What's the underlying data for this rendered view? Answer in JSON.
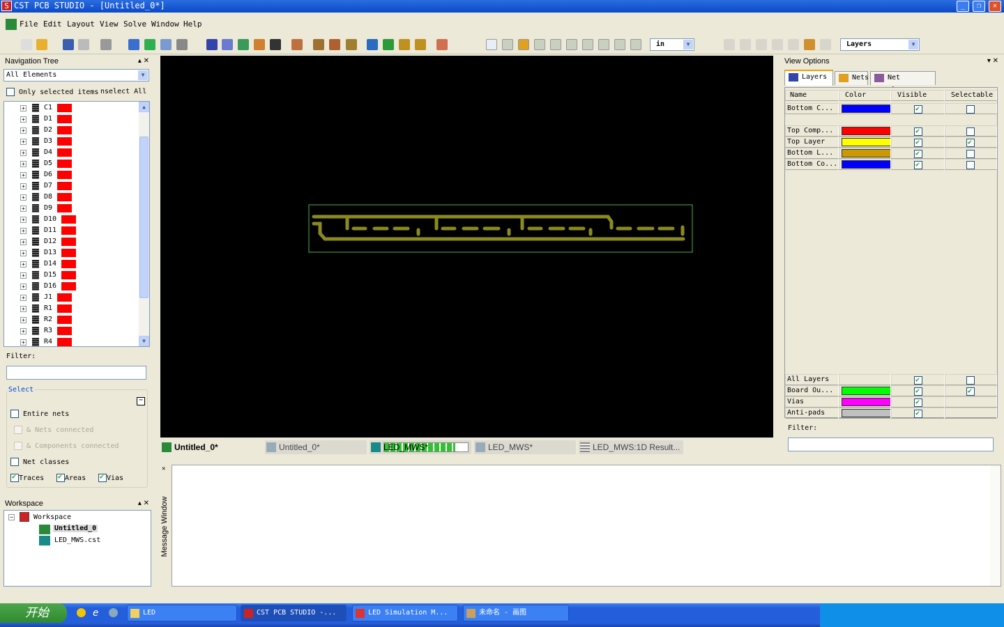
{
  "window": {
    "title": "CST PCB STUDIO - [Untitled_0*]",
    "logo": "S"
  },
  "menu": [
    "File",
    "Edit",
    "Layout",
    "View",
    "Solve",
    "Window",
    "Help"
  ],
  "toolbar": {
    "icons": [
      "new-file-icon",
      "open-folder-icon",
      "save-icon",
      "copy-icon",
      "print-icon",
      "import-icon",
      "circle-icon",
      "add-component-icon",
      "netlist-icon",
      "layers-icon",
      "calculator-icon",
      "check-icon",
      "net-icon",
      "chip-icon",
      "verify-icon",
      "trace-icon",
      "nets-icon",
      "component-icon",
      "ir-solver-icon",
      "pi-solver-icon",
      "fd-solver-icon",
      "td-solver-icon",
      "export-icon"
    ],
    "view_icons": [
      "select-arrow-icon",
      "zoom-icon",
      "pan-icon",
      "zoom-fit-icon",
      "zoom-window-icon",
      "grid1-icon",
      "grid2-icon",
      "grid3-icon",
      "grid4-icon",
      "grid5-icon"
    ],
    "unit_select": "in",
    "layers_select": "Layers",
    "right_icons": [
      "select-rect-icon",
      "probe-icon",
      "text-icon",
      "pin-icon",
      "grid-icon",
      "magnet-icon",
      "frame-icon"
    ]
  },
  "nav": {
    "title": "Navigation Tree",
    "filter_select": "All Elements",
    "only_selected": "Only selected items",
    "unselect_all": "nselect All",
    "items": [
      "C1",
      "D1",
      "D2",
      "D3",
      "D4",
      "D5",
      "D6",
      "D7",
      "D8",
      "D9",
      "D10",
      "D11",
      "D12",
      "D13",
      "D14",
      "D15",
      "D16",
      "J1",
      "R1",
      "R2",
      "R3",
      "R4"
    ],
    "swatch_color": "#ff0000",
    "filter_label": "Filter:",
    "filter_value": "",
    "select_group": "Select",
    "entire_nets": "Entire nets",
    "nets_connected": "& Nets connected",
    "components_connected": "& Components connected",
    "net_classes": "Net classes",
    "traces": "Traces",
    "areas": "Areas",
    "vias": "Vias"
  },
  "workspace": {
    "title": "Workspace",
    "root": "Workspace",
    "items": [
      "Untitled_0",
      "LED_MWS.cst"
    ]
  },
  "doc_tabs": [
    "Untitled_0*",
    "Untitled_0*",
    "LED_MWS*",
    "LED_MWS*",
    "LED_MWS:1D Result..."
  ],
  "progress": 0.85,
  "message_window": {
    "label": "Message Window"
  },
  "view_options": {
    "title": "View Options",
    "tabs": [
      "Layers",
      "Nets",
      "Net Classes"
    ],
    "columns": [
      "Name",
      "Color",
      "Visible",
      "Selectable"
    ],
    "rows": [
      {
        "name": "Bottom C...",
        "color": "#0000ff",
        "visible": true,
        "selectable": false
      },
      {
        "name": "Top Comp...",
        "color": "#ff0000",
        "visible": true,
        "selectable": false
      },
      {
        "name": "Top Layer",
        "color": "#ffff00",
        "visible": true,
        "selectable": true
      },
      {
        "name": "Bottom L...",
        "color": "#cc9900",
        "visible": true,
        "selectable": false
      },
      {
        "name": "Bottom Co...",
        "color": "#0000ff",
        "visible": true,
        "selectable": false
      }
    ],
    "bottom_rows": [
      {
        "name": "All Layers",
        "color": null,
        "visible": true,
        "selectable": false
      },
      {
        "name": "Board Ou...",
        "color": "#00ff00",
        "visible": true,
        "selectable": true
      },
      {
        "name": "Vias",
        "color": "#ff00ff",
        "visible": true,
        "selectable": null
      },
      {
        "name": "Anti-pads",
        "color": "#c0c0c0",
        "visible": true,
        "selectable": null
      }
    ],
    "filter_label": "Filter:"
  },
  "taskbar": {
    "start": "开始",
    "tasks": [
      "LED",
      "CST PCB STUDIO -...",
      "LED Simulation M...",
      "未命名 - 画图"
    ]
  },
  "colors": {
    "trace": "#8a8a1e",
    "board_outline": "#4caf50"
  }
}
